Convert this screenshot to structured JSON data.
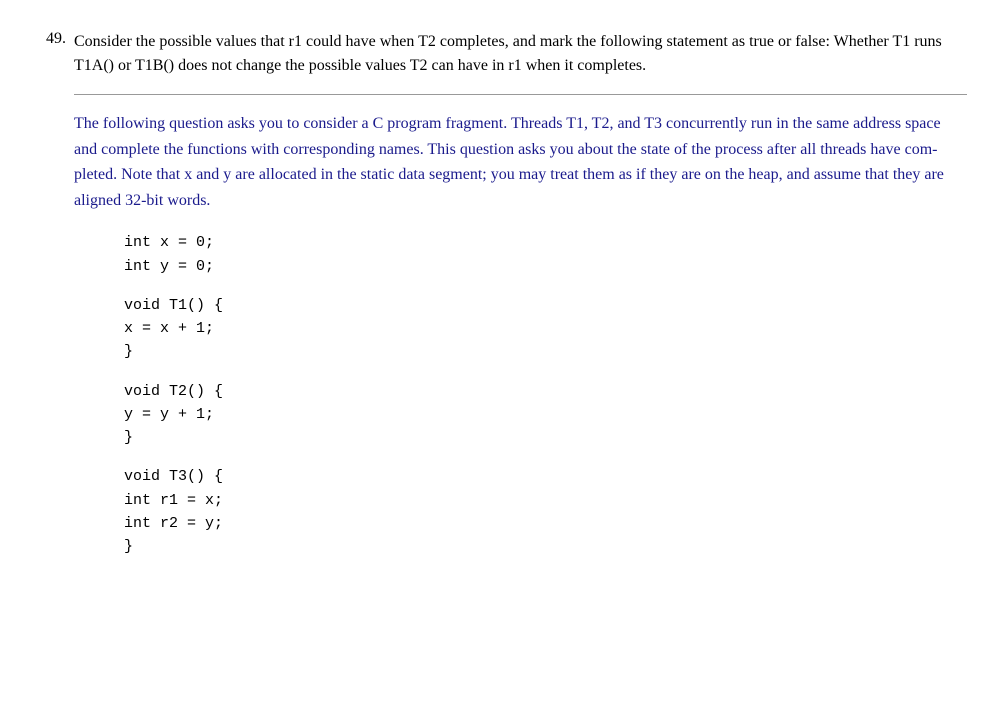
{
  "question": {
    "number": "49.",
    "text": "Consider the possible values that r1 could have when T2 completes, and mark the following statement as true or false: Whether T1 runs T1A() or T1B() does not change the possible values T2 can have in r1 when it completes."
  },
  "context": {
    "description": "The following question asks you to consider a C program fragment. Threads T1, T2, and T3 concurrently run in the same address space and complete the functions with corresponding names. This question asks you about the state of the process after all threads have com- pleted. Note that x and y are allocated in the static data segment; you may treat them as if they are on the heap, and assume that they are aligned 32-bit words."
  },
  "code": {
    "globals": [
      "int x = 0;",
      "int y = 0;"
    ],
    "t1": {
      "header": "void T1() {",
      "body": "    x = x + 1;",
      "close": "}"
    },
    "t2": {
      "header": "void T2() {",
      "body": "    y = y + 1;",
      "close": "}"
    },
    "t3": {
      "header": "void T3() {",
      "body_line1": "    int r1 = x;",
      "body_line2": "    int r2 = y;",
      "close": "}"
    }
  }
}
